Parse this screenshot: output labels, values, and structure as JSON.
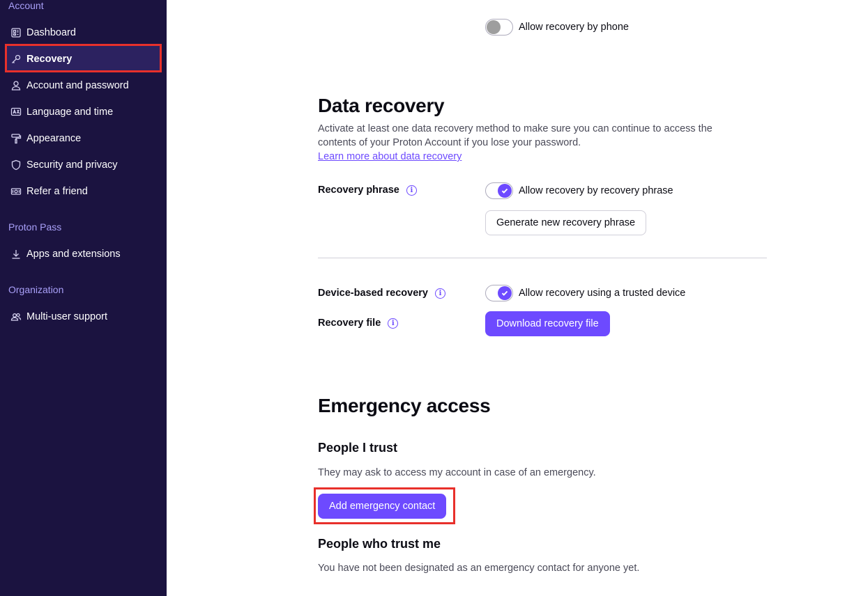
{
  "sidebar": {
    "sections": [
      {
        "title": "Account"
      },
      {
        "title": "Proton Pass"
      },
      {
        "title": "Organization"
      }
    ],
    "items": [
      {
        "label": "Dashboard",
        "icon": "dashboard-icon"
      },
      {
        "label": "Recovery",
        "icon": "key-icon",
        "active": true
      },
      {
        "label": "Account and password",
        "icon": "user-icon"
      },
      {
        "label": "Language and time",
        "icon": "language-icon"
      },
      {
        "label": "Appearance",
        "icon": "paint-roller-icon"
      },
      {
        "label": "Security and privacy",
        "icon": "shield-icon"
      },
      {
        "label": "Refer a friend",
        "icon": "money-icon"
      },
      {
        "label": "Apps and extensions",
        "icon": "download-icon"
      },
      {
        "label": "Multi-user support",
        "icon": "users-icon"
      }
    ]
  },
  "phone_recovery": {
    "toggle_label": "Allow recovery by phone",
    "enabled": false
  },
  "data_recovery": {
    "title": "Data recovery",
    "description": "Activate at least one data recovery method to make sure you can continue to access the contents of your Proton Account if you lose your password.",
    "description_line1": "Activate at least one data recovery method to make sure you can continue to access the",
    "description_line2": "contents of your Proton Account if you lose your password.",
    "learn_more": "Learn more about data recovery",
    "recovery_phrase": {
      "label": "Recovery phrase",
      "toggle_label": "Allow recovery by recovery phrase",
      "enabled": true,
      "button": "Generate new recovery phrase"
    },
    "device_recovery": {
      "label": "Device-based recovery",
      "toggle_label": "Allow recovery using a trusted device",
      "enabled": true
    },
    "recovery_file": {
      "label": "Recovery file",
      "button": "Download recovery file"
    }
  },
  "emergency_access": {
    "title": "Emergency access",
    "people_i_trust": {
      "title": "People I trust",
      "description": "They may ask to access my account in case of an emergency.",
      "button": "Add emergency contact"
    },
    "people_who_trust_me": {
      "title": "People who trust me",
      "description": "You have not been designated as an emergency contact for anyone yet."
    }
  },
  "colors": {
    "sidebar_bg": "#1b1340",
    "accent": "#6d4aff",
    "highlight": "#e8302b"
  }
}
